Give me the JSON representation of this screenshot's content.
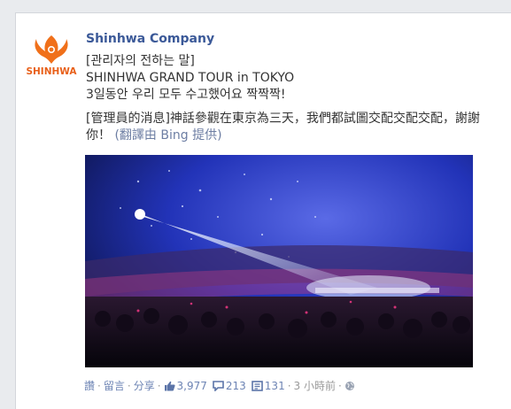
{
  "post": {
    "author": "Shinhwa Company",
    "avatar_text": "SHINHWA",
    "lines": [
      "[관리자의 전하는 말]",
      "SHINHWA GRAND TOUR in TOKYO",
      "3일동안 우리 모두 수고했어요 짝짝짝!"
    ],
    "translation_text": "[管理員的消息]神話參觀在東京為三天，我們都試圖交配交配交配，謝謝你！",
    "translation_credit": "(翻譯由 Bing 提供)"
  },
  "actions": {
    "like": "讚",
    "comment": "留言",
    "share": "分享",
    "likes_count": "3,977",
    "comments_count": "213",
    "shares_count": "131",
    "timestamp": "3 小時前",
    "separator": "·"
  },
  "colors": {
    "link": "#3b5998",
    "brand_orange": "#f0701a",
    "stage_blue": "#1a2a9a"
  }
}
